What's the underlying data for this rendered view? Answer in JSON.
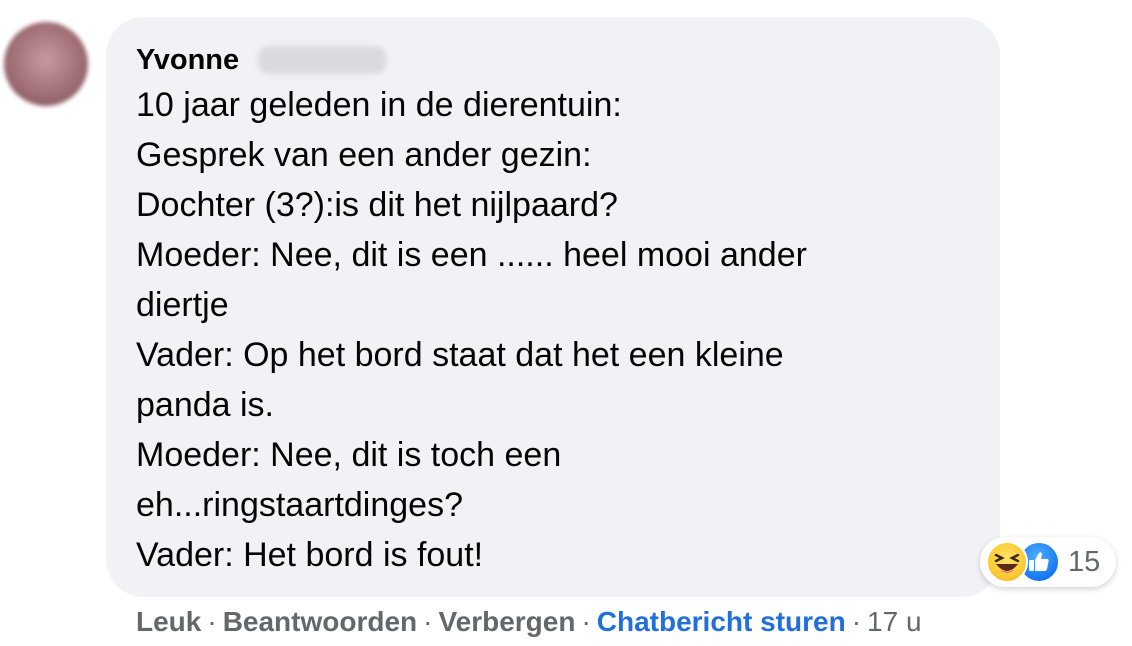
{
  "comment": {
    "author": "Yvonne",
    "lines": [
      "10 jaar geleden in de dierentuin:",
      "Gesprek van een ander gezin:",
      "Dochter (3?):is dit het nijlpaard?",
      "Moeder: Nee, dit is een ...... heel mooi ander",
      "diertje",
      "Vader: Op het bord staat dat het een kleine",
      "panda is.",
      "Moeder: Nee, dit is toch een",
      "eh...ringstaartdinges?",
      "Vader: Het bord is fout!"
    ]
  },
  "reactions": {
    "icons": [
      "haha-icon",
      "like-icon"
    ],
    "count": "15"
  },
  "actions": {
    "like": "Leuk",
    "reply": "Beantwoorden",
    "hide": "Verbergen",
    "message": "Chatbericht sturen",
    "separator": "·",
    "time": "17 u"
  },
  "colors": {
    "bubble": "#f0f2f5",
    "text": "#050505",
    "meta": "#65676b",
    "link": "#216fdb",
    "like_blue": "#1877f2",
    "haha_yellow": "#ffcc33"
  }
}
